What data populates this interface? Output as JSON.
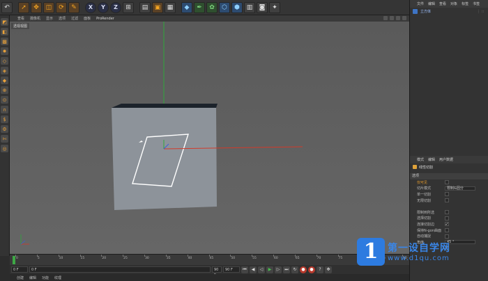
{
  "toolbar": {
    "icons": [
      "undo-icon",
      "cursor-icon",
      "move-icon",
      "scale-icon",
      "rotate-icon",
      "live-select-icon",
      "x-axis-icon",
      "y-axis-icon",
      "z-axis-icon",
      "world-coord-icon",
      "render-view-icon",
      "render-picture-icon",
      "render-settings-icon",
      "cube-icon",
      "pen-icon",
      "subdivision-icon",
      "deformer-icon",
      "array-icon",
      "scene-icon",
      "camera-icon",
      "light-icon"
    ],
    "x_label": "X",
    "y_label": "Y",
    "z_label": "Z"
  },
  "viewport_menu": {
    "items": [
      "查看",
      "摄像机",
      "显示",
      "选项",
      "过滤",
      "面板"
    ],
    "prorender": "ProRender"
  },
  "viewport": {
    "label": "透视视图"
  },
  "object_manager": {
    "menu": [
      "文件",
      "编辑",
      "查看",
      "对象",
      "标签",
      "书签"
    ],
    "object_name": "立方体",
    "object_dots": "⋮ ∷"
  },
  "attributes": {
    "menu": [
      "模式",
      "编辑",
      "用户数据"
    ],
    "tool_name": "线性切割",
    "section": "选项",
    "props": [
      {
        "name": "仅可见",
        "type": "check",
        "checked": false,
        "highlight": true
      },
      {
        "name": "切片模式",
        "type": "field",
        "value": "限制&固分"
      },
      {
        "name": "单一切割",
        "type": "check",
        "checked": false
      },
      {
        "name": "无限切割",
        "type": "check",
        "checked": false
      },
      {
        "name": "",
        "type": "spacer"
      },
      {
        "name": "限制到所选",
        "type": "check",
        "checked": false
      },
      {
        "name": "选择切割",
        "type": "check",
        "checked": false
      },
      {
        "name": "连接切割边",
        "type": "check",
        "checked": true
      },
      {
        "name": "保持N-gon曲面",
        "type": "check",
        "checked": false
      },
      {
        "name": "自动捕捉",
        "type": "check",
        "checked": false
      },
      {
        "name": "角度",
        "type": "field",
        "value": "45 °"
      },
      {
        "name": "",
        "type": "check",
        "checked": true
      }
    ]
  },
  "timeline": {
    "ticks": [
      "0",
      "5",
      "10",
      "15",
      "20",
      "25",
      "30",
      "35",
      "40",
      "45",
      "50",
      "55",
      "60",
      "65",
      "70",
      "75",
      "80",
      "85",
      "90"
    ],
    "start_field": "0 F",
    "start_field2": "0 F",
    "end_field": "90 F",
    "end_field2": "90 F"
  },
  "statusbar": {
    "items": [
      "创建",
      "编辑",
      "功能",
      "纹理"
    ]
  },
  "watermark": {
    "logo": "1",
    "title": "第一设自学网",
    "url": "www.d1qu.com"
  },
  "colors": {
    "accent": "#f5a623",
    "viewport_bg": "#5c5c5c",
    "cube_face": "#8c9299",
    "cube_top": "#1c232b",
    "x_axis": "#d23a2a",
    "y_axis": "#2ea83a",
    "cut_line": "#ffffff"
  }
}
